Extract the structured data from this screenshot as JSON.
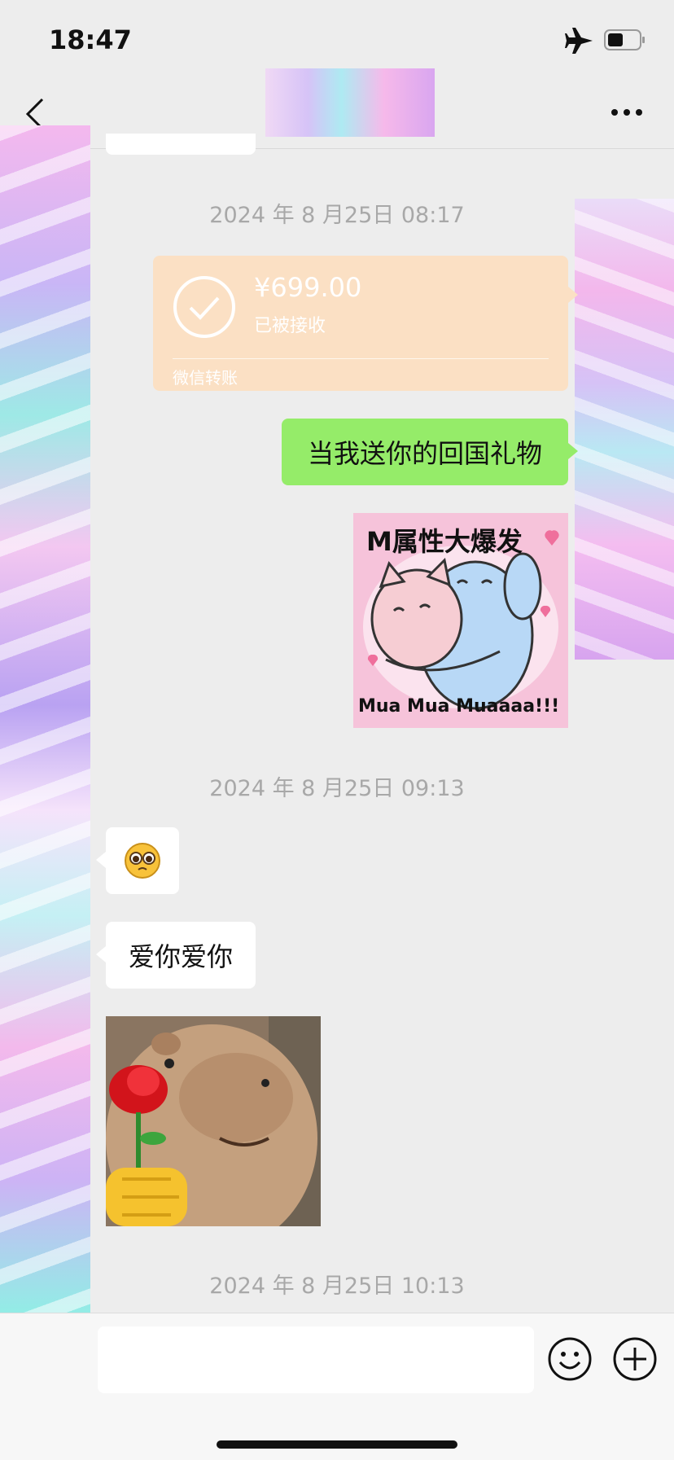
{
  "status_bar": {
    "time": "18:47"
  },
  "messages": {
    "timestamp_1": "2024 年 8 月25日 08:17",
    "transfer": {
      "amount": "¥699.00",
      "status": "已被接收",
      "label": "微信转账"
    },
    "sent_text": "当我送你的回国礼物",
    "sticker_hug": {
      "title": "M属性大爆发",
      "caption": "Mua Mua Muaaaa!!!"
    },
    "timestamp_2": "2024 年 8 月25日 09:13",
    "received_text": "爱你爱你",
    "timestamp_3": "2024 年 8 月25日 10:13"
  },
  "colors": {
    "sent_bubble": "#95ec69",
    "transfer_card": "#fbe0c4",
    "background": "#ededed"
  },
  "icons": [
    "airplane-icon",
    "battery-icon",
    "back-icon",
    "more-icon",
    "check-circle-icon",
    "pleading-emoji-icon",
    "emoji-icon",
    "plus-icon"
  ]
}
